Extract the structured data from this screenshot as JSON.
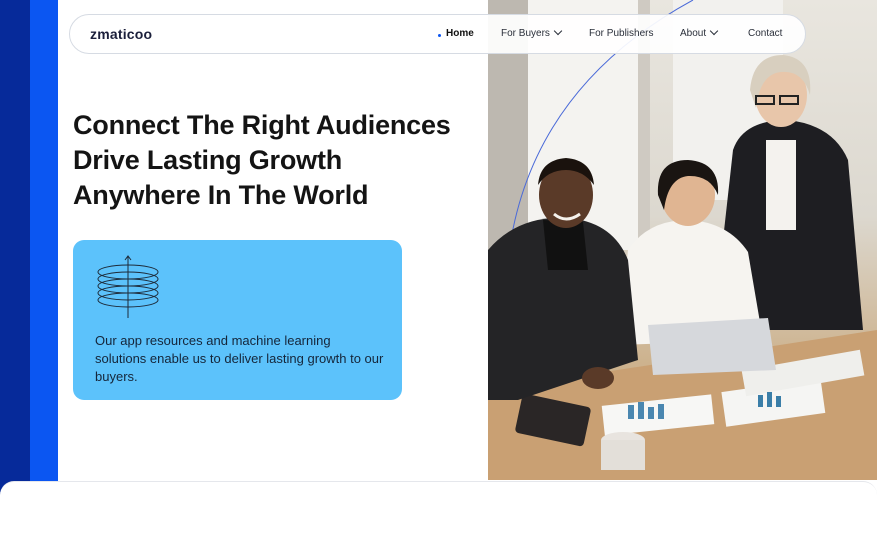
{
  "brand": {
    "logo_text": "zmaticoo"
  },
  "nav": {
    "items": [
      {
        "label": "Home",
        "active": true
      },
      {
        "label": "For Buyers",
        "dropdown": true
      },
      {
        "label": "For Publishers"
      },
      {
        "label": "About",
        "dropdown": true
      },
      {
        "label": "Contact"
      }
    ]
  },
  "hero": {
    "headline_lines": [
      "Connect The Right Audiences",
      "Drive Lasting Growth",
      "Anywhere In The World"
    ],
    "card": {
      "icon": "stacked-rings-icon",
      "text": "Our app resources and machine learning solutions enable us to deliver lasting growth to our buyers."
    },
    "image": {
      "icon": "team-meeting-photo"
    }
  },
  "colors": {
    "accent_dark": "#062a9a",
    "accent": "#0b56f2",
    "card_bg": "#5cc2fb"
  }
}
